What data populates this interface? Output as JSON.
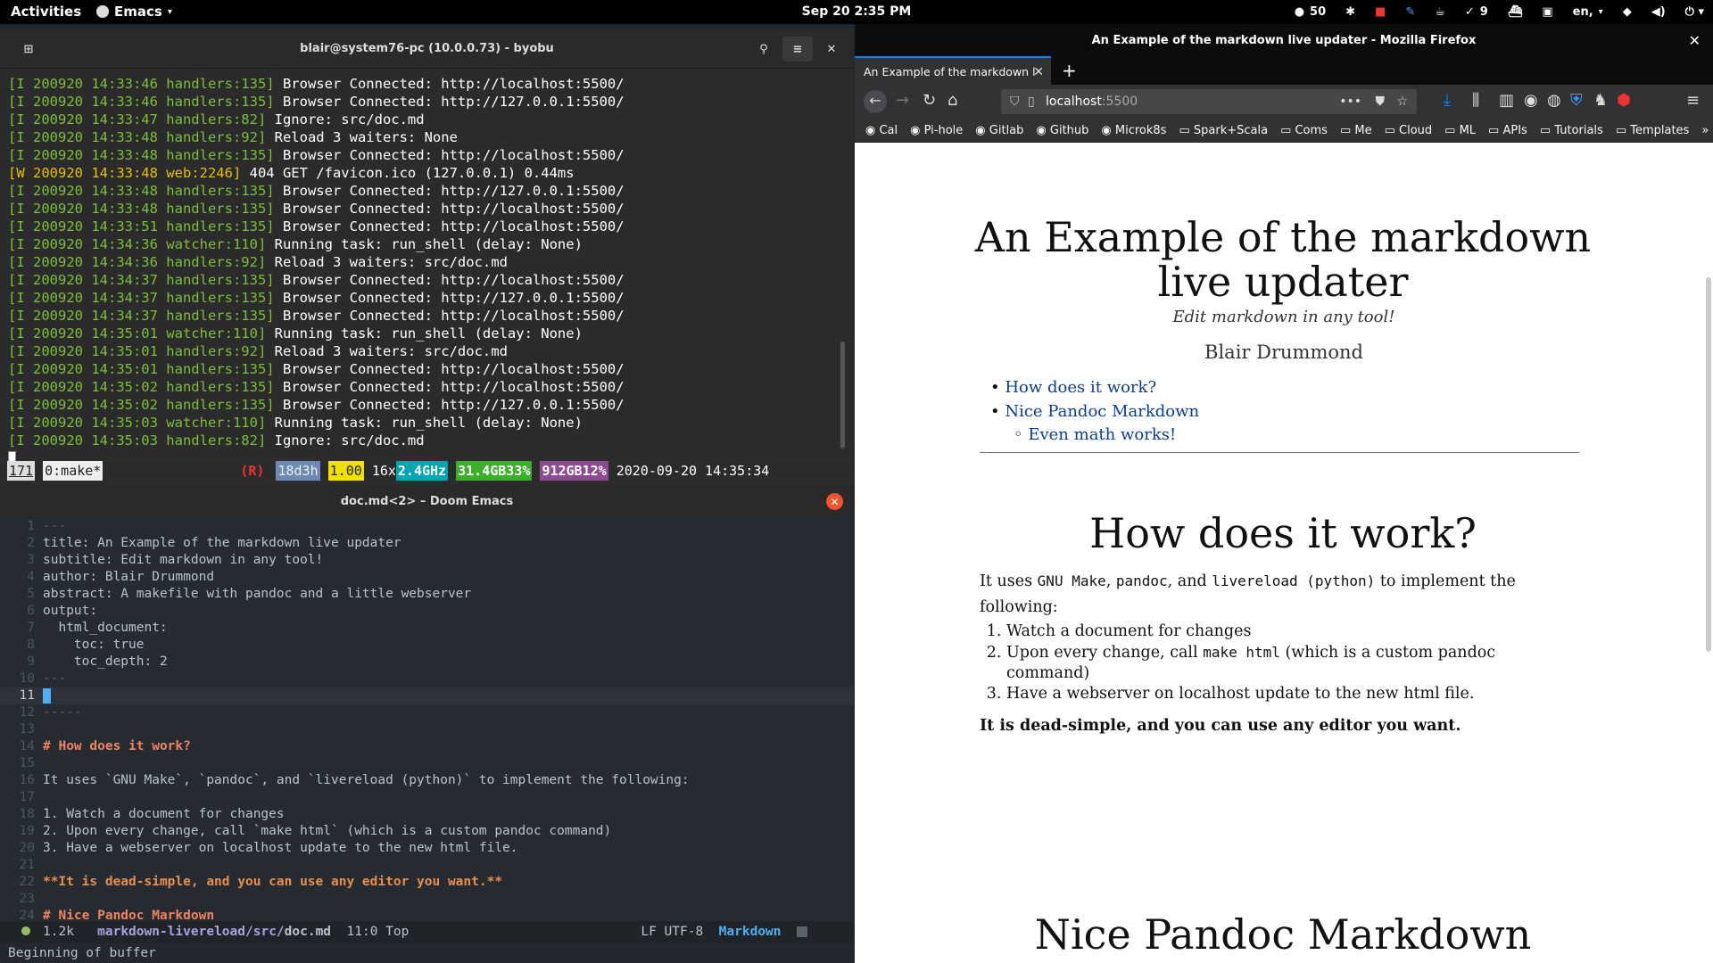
{
  "topbar": {
    "activities": "Activities",
    "app_name": "Emacs",
    "clock": "Sep 20  2:35 PM",
    "github_count": "50",
    "tasks_count": "9",
    "language": "en,"
  },
  "terminal": {
    "title": "blair@system76-pc (10.0.0.73) - byobu",
    "log_lines": [
      {
        "prefix": "[I 200920 14:33:46 handlers:135]",
        "msg": " Browser Connected: http://localhost:5500/",
        "level": "I"
      },
      {
        "prefix": "[I 200920 14:33:46 handlers:135]",
        "msg": " Browser Connected: http://127.0.0.1:5500/",
        "level": "I"
      },
      {
        "prefix": "[I 200920 14:33:47 handlers:82]",
        "msg": " Ignore: src/doc.md",
        "level": "I"
      },
      {
        "prefix": "[I 200920 14:33:48 handlers:92]",
        "msg": " Reload 3 waiters: None",
        "level": "I"
      },
      {
        "prefix": "[I 200920 14:33:48 handlers:135]",
        "msg": " Browser Connected: http://localhost:5500/",
        "level": "I"
      },
      {
        "prefix": "[W 200920 14:33:48 web:2246]",
        "msg": " 404 GET /favicon.ico (127.0.0.1) 0.44ms",
        "level": "W"
      },
      {
        "prefix": "[I 200920 14:33:48 handlers:135]",
        "msg": " Browser Connected: http://127.0.0.1:5500/",
        "level": "I"
      },
      {
        "prefix": "[I 200920 14:33:48 handlers:135]",
        "msg": " Browser Connected: http://localhost:5500/",
        "level": "I"
      },
      {
        "prefix": "[I 200920 14:33:51 handlers:135]",
        "msg": " Browser Connected: http://localhost:5500/",
        "level": "I"
      },
      {
        "prefix": "[I 200920 14:34:36 watcher:110]",
        "msg": " Running task: run_shell (delay: None)",
        "level": "I"
      },
      {
        "prefix": "[I 200920 14:34:36 handlers:92]",
        "msg": " Reload 3 waiters: src/doc.md",
        "level": "I"
      },
      {
        "prefix": "[I 200920 14:34:37 handlers:135]",
        "msg": " Browser Connected: http://localhost:5500/",
        "level": "I"
      },
      {
        "prefix": "[I 200920 14:34:37 handlers:135]",
        "msg": " Browser Connected: http://127.0.0.1:5500/",
        "level": "I"
      },
      {
        "prefix": "[I 200920 14:34:37 handlers:135]",
        "msg": " Browser Connected: http://localhost:5500/",
        "level": "I"
      },
      {
        "prefix": "[I 200920 14:35:01 watcher:110]",
        "msg": " Running task: run_shell (delay: None)",
        "level": "I"
      },
      {
        "prefix": "[I 200920 14:35:01 handlers:92]",
        "msg": " Reload 3 waiters: src/doc.md",
        "level": "I"
      },
      {
        "prefix": "[I 200920 14:35:01 handlers:135]",
        "msg": " Browser Connected: http://localhost:5500/",
        "level": "I"
      },
      {
        "prefix": "[I 200920 14:35:02 handlers:135]",
        "msg": " Browser Connected: http://localhost:5500/",
        "level": "I"
      },
      {
        "prefix": "[I 200920 14:35:02 handlers:135]",
        "msg": " Browser Connected: http://127.0.0.1:5500/",
        "level": "I"
      },
      {
        "prefix": "[I 200920 14:35:03 watcher:110]",
        "msg": " Running task: run_shell (delay: None)",
        "level": "I"
      },
      {
        "prefix": "[I 200920 14:35:03 handlers:82]",
        "msg": " Ignore: src/doc.md",
        "level": "I"
      }
    ],
    "status": {
      "window_index": "171",
      "session": "0:make*",
      "restart": "(R)",
      "uptime": "18d3h",
      "load": "1.00",
      "cpu_count": "16x",
      "cpu_freq": "2.4GHz",
      "mem": "31.4GB33%",
      "disk": "912GB12%",
      "datetime": "2020-09-20 14:35:34"
    }
  },
  "emacs": {
    "title": "doc.md<2> – Doom Emacs",
    "lines": [
      {
        "n": "1",
        "t": "---"
      },
      {
        "n": "2",
        "t": "title: An Example of the markdown live updater"
      },
      {
        "n": "3",
        "t": "subtitle: Edit markdown in any tool!"
      },
      {
        "n": "4",
        "t": "author: Blair Drummond"
      },
      {
        "n": "5",
        "t": "abstract: A makefile with pandoc and a little webserver"
      },
      {
        "n": "6",
        "t": "output:"
      },
      {
        "n": "7",
        "t": "  html_document:"
      },
      {
        "n": "8",
        "t": "    toc: true"
      },
      {
        "n": "9",
        "t": "    toc_depth: 2"
      },
      {
        "n": "10",
        "t": "---"
      },
      {
        "n": "11",
        "t": ""
      },
      {
        "n": "12",
        "t": "-----"
      },
      {
        "n": "13",
        "t": ""
      },
      {
        "n": "14",
        "t": "# How does it work?"
      },
      {
        "n": "15",
        "t": ""
      },
      {
        "n": "16",
        "t": "It uses `GNU Make`, `pandoc`, and `livereload (python)` to implement the following:"
      },
      {
        "n": "17",
        "t": ""
      },
      {
        "n": "18",
        "t": "1. Watch a document for changes"
      },
      {
        "n": "19",
        "t": "2. Upon every change, call `make html` (which is a custom pandoc command)"
      },
      {
        "n": "20",
        "t": "3. Have a webserver on localhost update to the new html file."
      },
      {
        "n": "21",
        "t": ""
      },
      {
        "n": "22",
        "t": "**It is dead-simple, and you can use any editor you want.**"
      },
      {
        "n": "23",
        "t": ""
      },
      {
        "n": "24",
        "t": "# Nice Pandoc Markdown"
      }
    ],
    "modeline": {
      "size": "1.2k",
      "project": "markdown-livereload/",
      "dir": "src/",
      "file": "doc.md",
      "position": "11:0 Top",
      "encoding": "LF UTF-8",
      "mode": "Markdown"
    },
    "echo": "Beginning of buffer"
  },
  "firefox": {
    "window_title": "An Example of the markdown live updater - Mozilla Firefox",
    "tab_title": "An Example of the markdown l",
    "url_host": "localhost",
    "url_port": ":5500",
    "bookmarks": [
      "Cal",
      "Pi-hole",
      "Gitlab",
      "Github",
      "Microk8s",
      "Spark+Scala",
      "Coms",
      "Me",
      "Cloud",
      "ML",
      "APIs",
      "Tutorials",
      "Templates"
    ]
  },
  "doc": {
    "title": "An Example of the markdown live updater",
    "subtitle": "Edit markdown in any tool!",
    "author": "Blair Drummond",
    "toc": [
      "How does it work?",
      "Nice Pandoc Markdown",
      "Even math works!"
    ],
    "h_how": "How does it work?",
    "intro_1": "It uses ",
    "code_make": "GNU Make",
    "sep_1": ", ",
    "code_pandoc": "pandoc",
    "sep_2": ", and ",
    "code_livereload": "livereload (python)",
    "intro_2": " to implement the following:",
    "steps": [
      "Watch a document for changes",
      "Upon every change, call ",
      "Have a webserver on localhost update to the new html file."
    ],
    "step2_code": "make html",
    "step2_rest": " (which is a custom pandoc command)",
    "bold_line": "It is dead-simple, and you can use any editor you want.",
    "h_nice": "Nice Pandoc Markdown"
  }
}
